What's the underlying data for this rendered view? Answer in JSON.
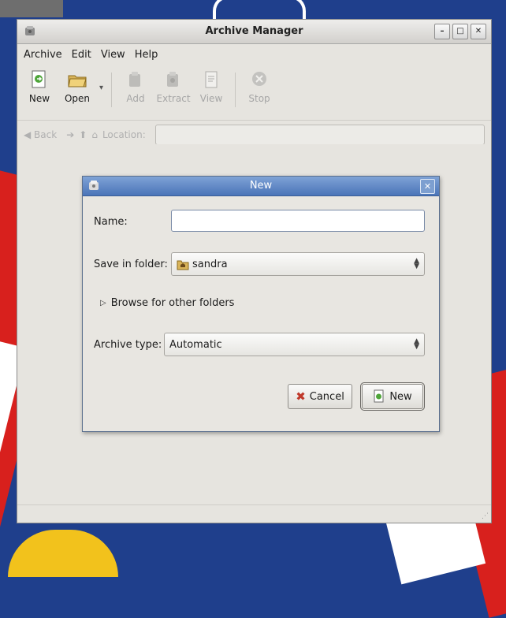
{
  "window": {
    "title": "Archive Manager",
    "menu": [
      {
        "label": "Archive"
      },
      {
        "label": "Edit"
      },
      {
        "label": "View"
      },
      {
        "label": "Help"
      }
    ],
    "toolbar": {
      "new": "New",
      "open": "Open",
      "add": "Add",
      "extract": "Extract",
      "view": "View",
      "stop": "Stop"
    },
    "locationbar": {
      "back": "Back",
      "location": "Location:"
    }
  },
  "dialog": {
    "title": "New",
    "name_label": "Name:",
    "name_value": "",
    "save_in_label": "Save in folder:",
    "save_in_value": "sandra",
    "browse_label": "Browse for other folders",
    "archive_type_label": "Archive type:",
    "archive_type_value": "Automatic",
    "cancel": "Cancel",
    "new": "New"
  },
  "colors": {
    "desktop": "#1f3f8c",
    "dialog_title": "#4a74b8",
    "window_bg": "#e6e4df"
  }
}
